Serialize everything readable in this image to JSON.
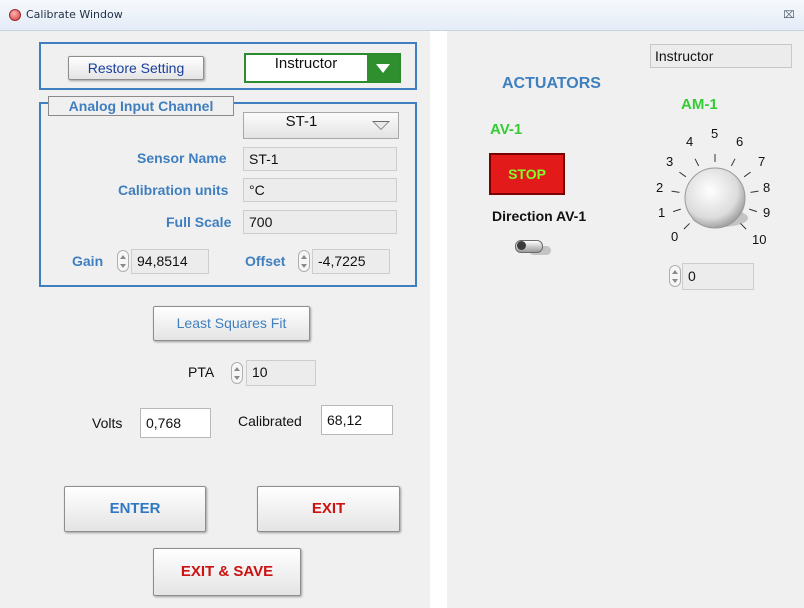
{
  "window": {
    "title": "Calibrate Window",
    "close_icon": "close-icon"
  },
  "top": {
    "restore_label": "Restore Setting",
    "role_value": "Instructor"
  },
  "analog": {
    "group_label": "Analog Input Channel",
    "channel_value": "ST-1",
    "sensor_name_label": "Sensor Name",
    "sensor_name_value": "ST-1",
    "units_label": "Calibration units",
    "units_value": "°C",
    "full_scale_label": "Full Scale",
    "full_scale_value": "700",
    "gain_label": "Gain",
    "gain_value": "94,8514",
    "offset_label": "Offset",
    "offset_value": "-4,7225"
  },
  "fit": {
    "label": "Least Squares  Fit"
  },
  "pta": {
    "label": "PTA",
    "value": "10"
  },
  "readings": {
    "volts_label": "Volts",
    "volts_value": "0,768",
    "calibrated_label": "Calibrated",
    "calibrated_value": "68,12"
  },
  "actions": {
    "enter_label": "ENTER",
    "exit_label": "EXIT",
    "exit_save_label": "EXIT & SAVE"
  },
  "right": {
    "role_indicator": "Instructor",
    "actuators_label": "ACTUATORS",
    "av_label": "AV-1",
    "stop_label": "STOP",
    "direction_label": "Direction AV-1",
    "am_label": "AM-1",
    "dial_ticks": [
      "0",
      "1",
      "2",
      "3",
      "4",
      "5",
      "6",
      "7",
      "8",
      "9",
      "10"
    ],
    "am_value": "0"
  },
  "colors": {
    "accent_blue": "#3f7fbf",
    "green": "#33cc33",
    "stop_red": "#e21a1a",
    "exit_red": "#cc1111"
  }
}
